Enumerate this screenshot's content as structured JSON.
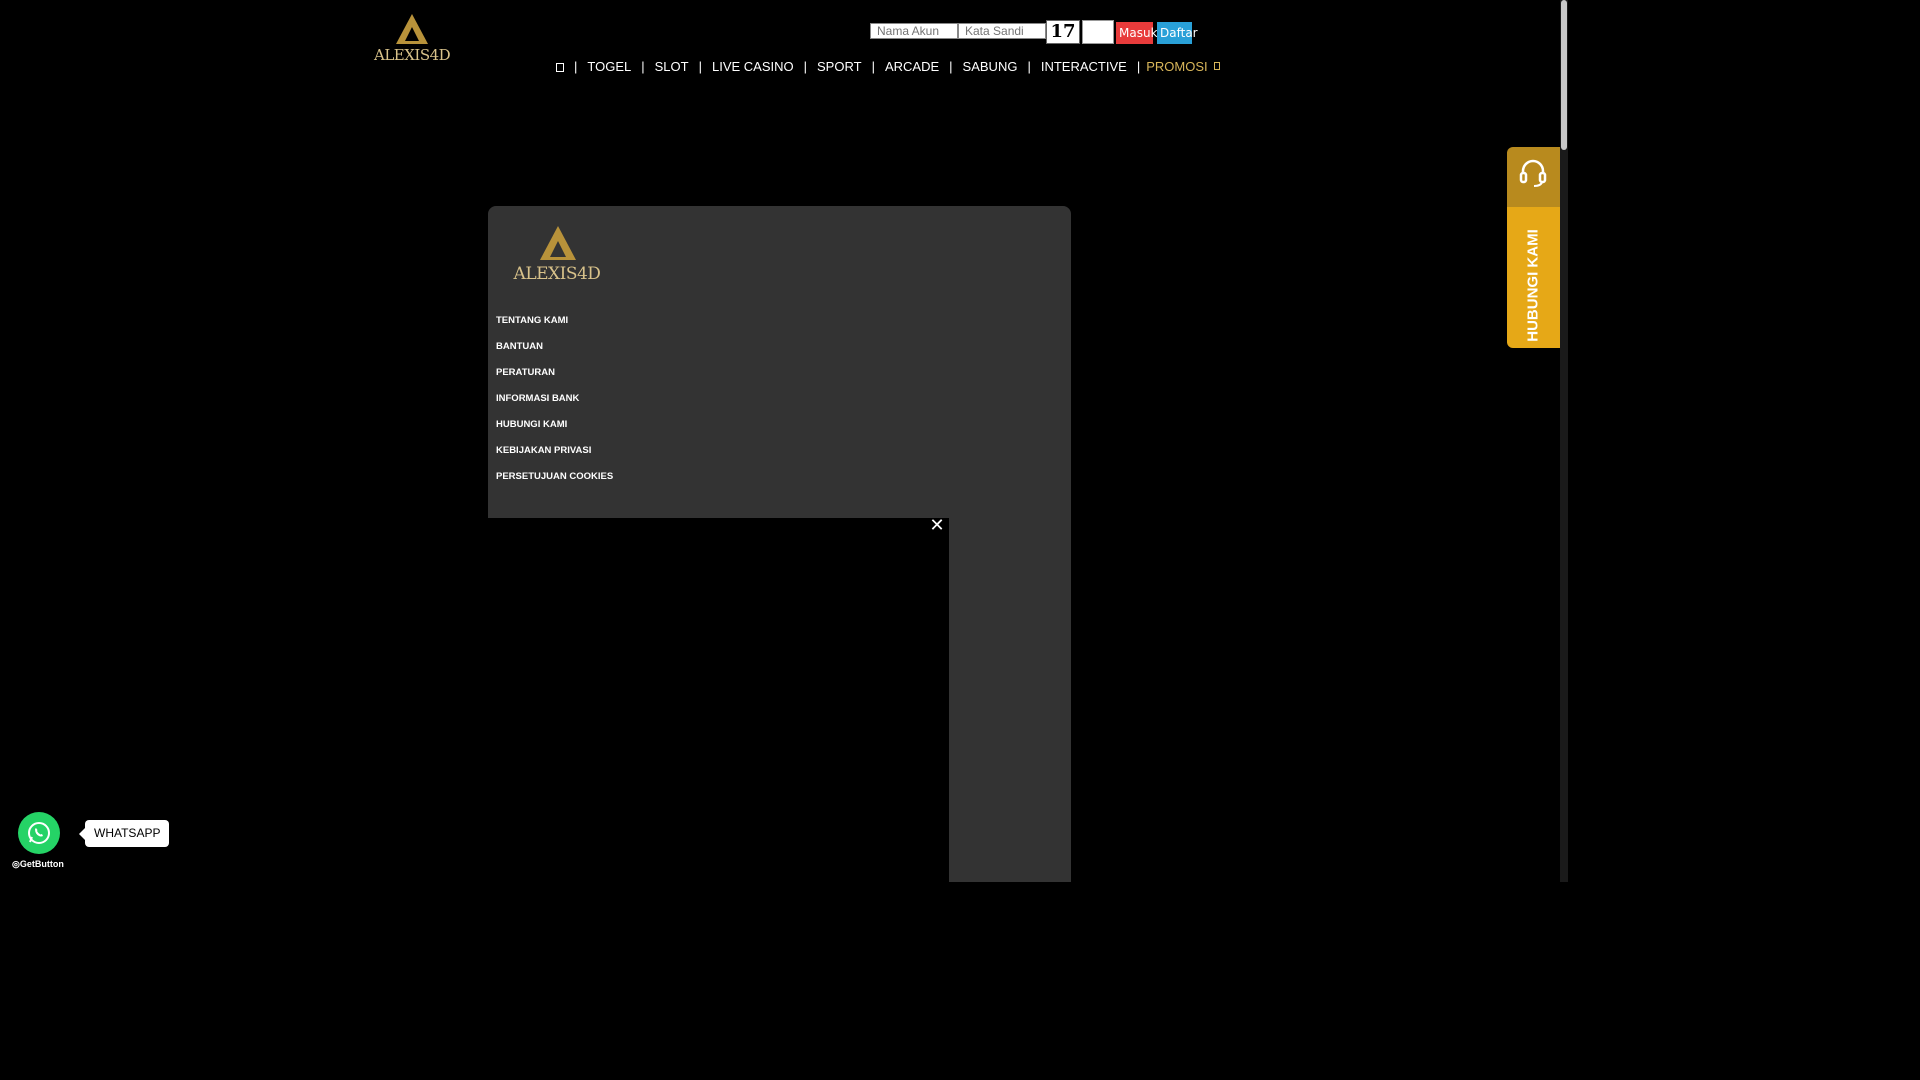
{
  "brand": {
    "logo_text": "ALEXIS4D"
  },
  "login": {
    "username_placeholder": "Nama Akun",
    "password_placeholder": "Kata Sandi",
    "captcha_text": "17",
    "login_label": "Masuk",
    "register_label": "Daftar"
  },
  "nav": {
    "items": [
      "TOGEL",
      "SLOT",
      "LIVE CASINO",
      "SPORT",
      "ARCADE",
      "SABUNG",
      "INTERACTIVE"
    ],
    "promo_label": "PROMOSI",
    "separator": "|"
  },
  "panel": {
    "logo_text": "ALEXIS4D",
    "menu": [
      "TENTANG KAMI",
      "BANTUAN",
      "PERATURAN",
      "INFORMASI BANK",
      "HUBUNGI KAMI",
      "KEBIJAKAN PRIVASI",
      "PERSETUJUAN COOKIES"
    ]
  },
  "video": {
    "close_symbol": "✕"
  },
  "contact_tab": {
    "label": "HUBUNGI KAMI",
    "icon": "headset-icon"
  },
  "whatsapp": {
    "label": "WHATSAPP",
    "powered_by": "GetButton",
    "icon": "whatsapp-icon",
    "color": "#25d366"
  },
  "colors": {
    "accent_gold": "#d8b65a",
    "login_red": "#e83b3b",
    "register_blue": "#29a0d8",
    "contact_orange": "#e6a817"
  }
}
